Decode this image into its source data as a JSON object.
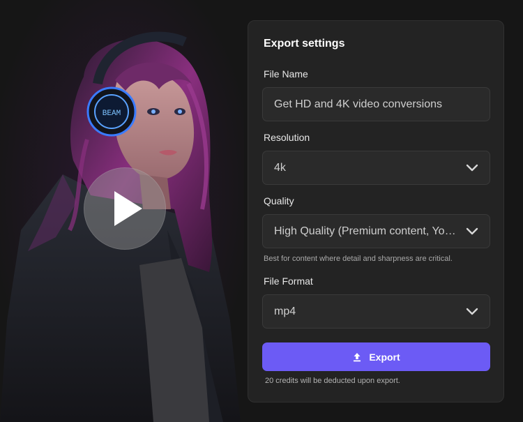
{
  "media": {
    "preview_alt": "preview-image",
    "headphone_text": "BEAM"
  },
  "panel": {
    "title": "Export settings",
    "file_name": {
      "label": "File Name",
      "value": "Get HD and 4K video conversions"
    },
    "resolution": {
      "label": "Resolution",
      "value": "4k"
    },
    "quality": {
      "label": "Quality",
      "value": "High Quality (Premium content, You...",
      "hint": "Best for content where detail and sharpness are critical."
    },
    "file_format": {
      "label": "File Format",
      "value": "mp4"
    },
    "export_label": "Export",
    "credits_note": "20 credits will be deducted upon export."
  },
  "colors": {
    "accent": "#6c5bf5",
    "background": "#161616",
    "panel": "#232323",
    "field": "#2a2a2a"
  },
  "icons": {
    "play": "play-icon",
    "chevron": "chevron-down-icon",
    "upload": "upload-icon"
  }
}
